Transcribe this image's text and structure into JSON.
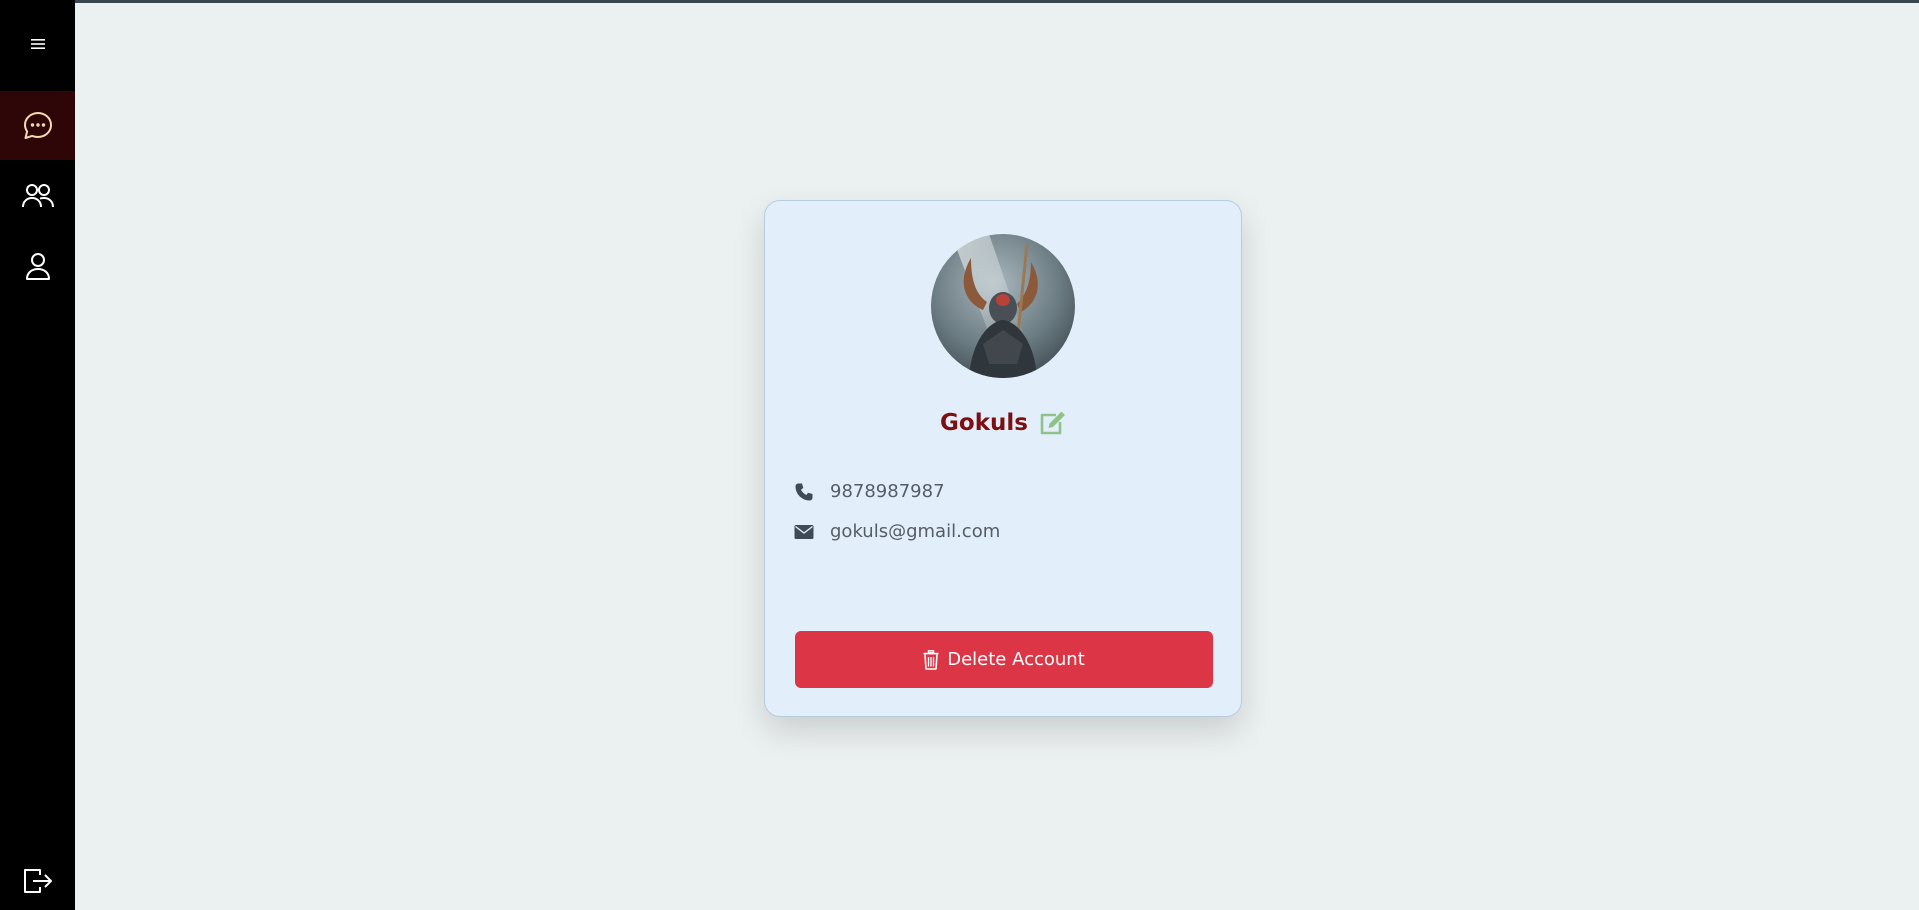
{
  "sidebar": {
    "items": [
      {
        "name": "menu",
        "icon": "hamburger-icon"
      },
      {
        "name": "chats",
        "icon": "chat-icon",
        "active": true
      },
      {
        "name": "friends",
        "icon": "people-icon"
      },
      {
        "name": "profile",
        "icon": "person-icon"
      }
    ],
    "logout_icon": "logout-icon",
    "active_color": "#2e0607"
  },
  "profile": {
    "avatar_icon": "avatar-image",
    "name": "Gokuls",
    "name_color": "#7c0f12",
    "edit_icon": "edit-icon",
    "phone": "9878987987",
    "email": "gokuls@gmail.com",
    "delete_label": "Delete Account",
    "delete_color": "#dc3545"
  }
}
